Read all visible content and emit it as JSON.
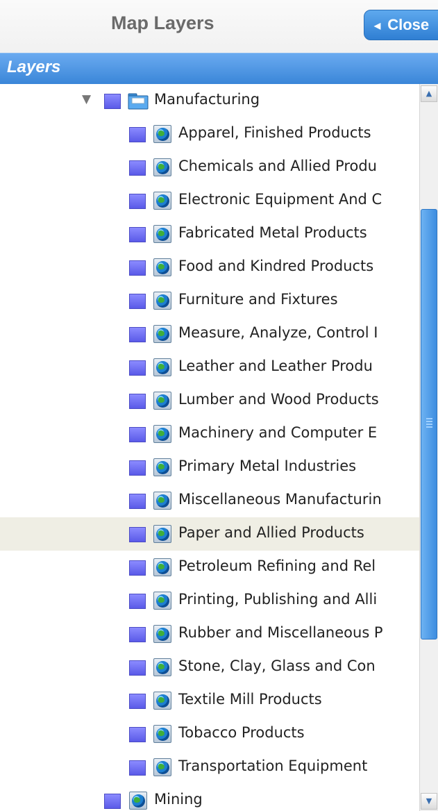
{
  "header": {
    "title": "Map Layers",
    "close_label": "Close"
  },
  "layers_bar": {
    "label": "Layers"
  },
  "tree": {
    "parent": {
      "label": "Manufacturing",
      "expanded": true,
      "icon": "folder-icon"
    },
    "children": [
      "Apparel, Finished Products",
      "Chemicals and Allied Produ",
      "Electronic Equipment And C",
      "Fabricated Metal Products",
      "Food and Kindred Products",
      "Furniture and Fixtures",
      "Measure, Analyze, Control I",
      "Leather and Leather Produ",
      "Lumber and Wood Products",
      "Machinery and Computer E",
      "Primary Metal Industries",
      "Miscellaneous Manufacturin",
      "Paper and Allied Products",
      "Petroleum Refining and Rel",
      "Printing, Publishing and Alli",
      "Rubber and Miscellaneous P",
      "Stone, Clay, Glass and Con",
      "Textile Mill Products",
      "Tobacco Products",
      "Transportation Equipment"
    ],
    "selected_child": "Paper and Allied Products",
    "next_sibling": "Mining"
  },
  "colors": {
    "accent": "#3a86d8",
    "checkbox": "#6b6bf2",
    "selected_row": "#efeee4"
  }
}
